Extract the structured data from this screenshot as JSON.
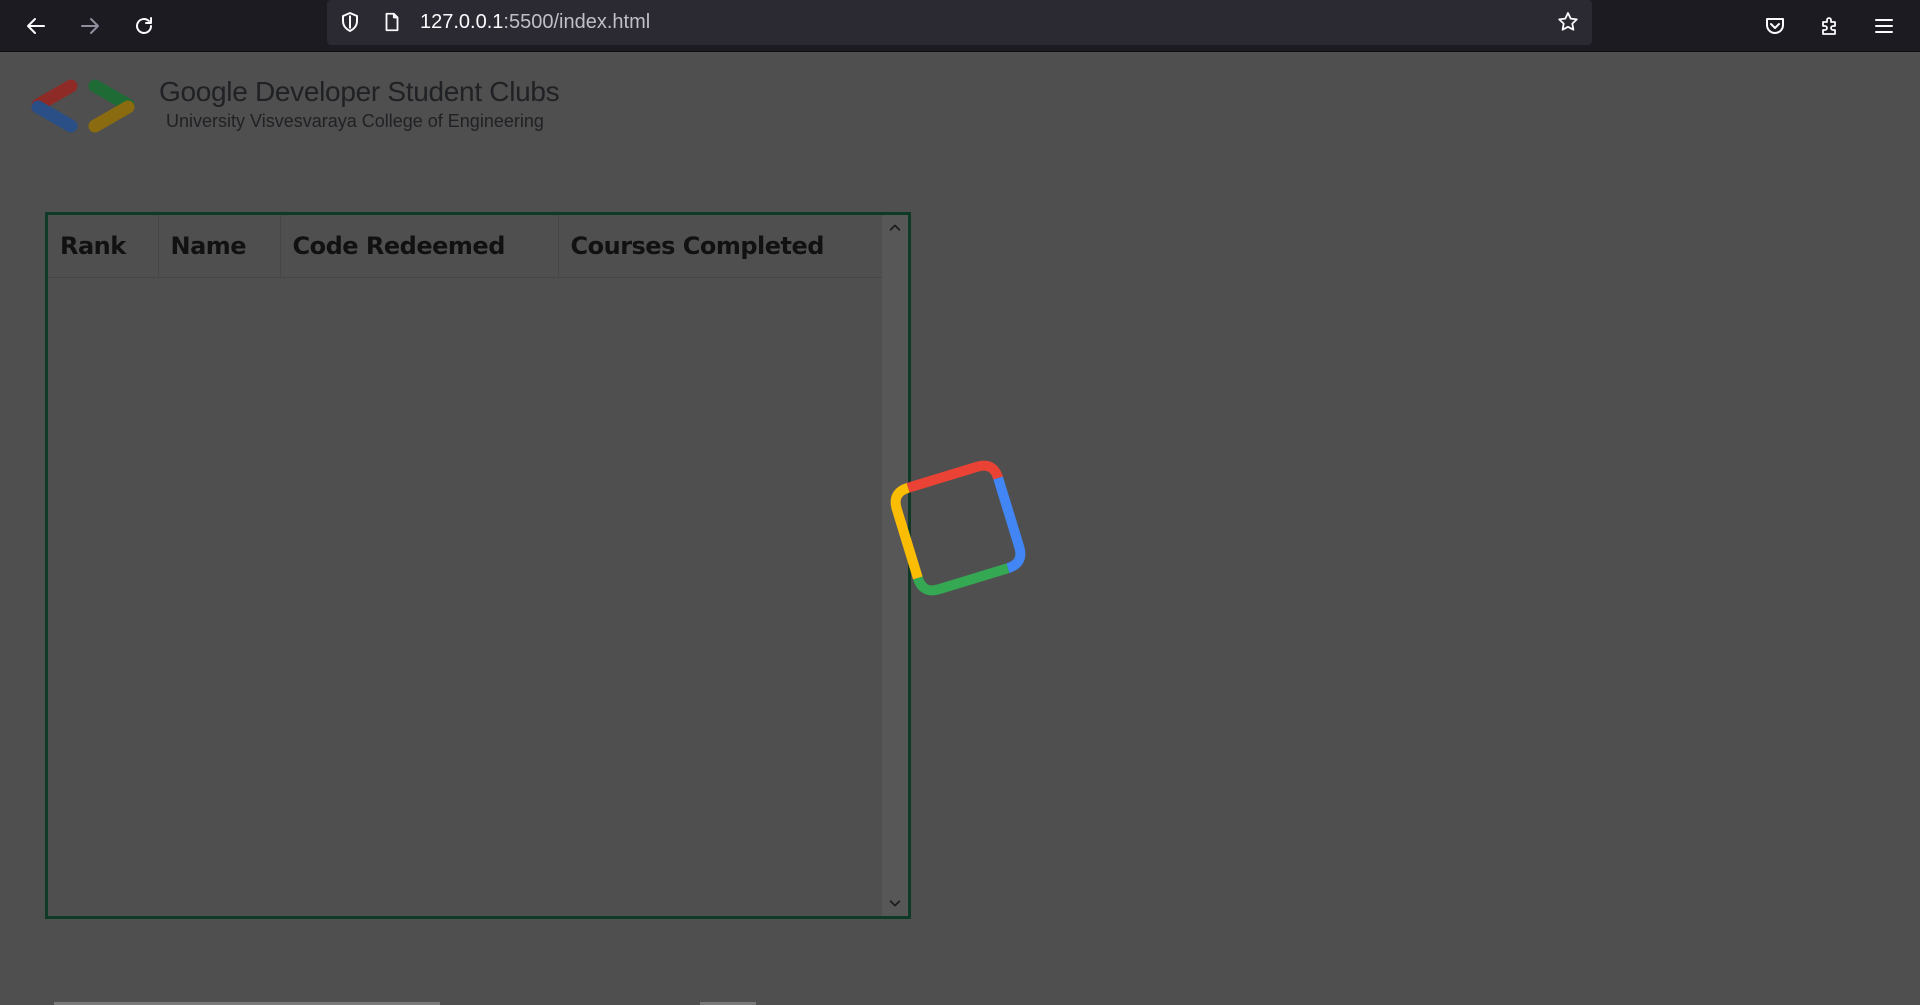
{
  "browser": {
    "url_host": "127.0.0.1",
    "url_path": ":5500/index.html",
    "icons": {
      "back": "arrow-left-icon",
      "forward": "arrow-right-icon",
      "reload": "reload-icon",
      "tracking": "shield-icon",
      "page": "page-icon",
      "bookmark": "star-icon",
      "pocket": "pocket-icon",
      "extensions": "puzzle-icon",
      "menu": "hamburger-icon"
    }
  },
  "header": {
    "title": "Google Developer Student Clubs",
    "subtitle": "University Visvesvaraya College of Engineering"
  },
  "leaderboard": {
    "columns": [
      "Rank",
      "Name",
      "Code Redeemed",
      "Courses Completed"
    ],
    "rows": []
  },
  "loader": {
    "colors": {
      "red": "#ea4335",
      "blue": "#4285f4",
      "green": "#34a853",
      "yellow": "#fbbc04"
    }
  }
}
